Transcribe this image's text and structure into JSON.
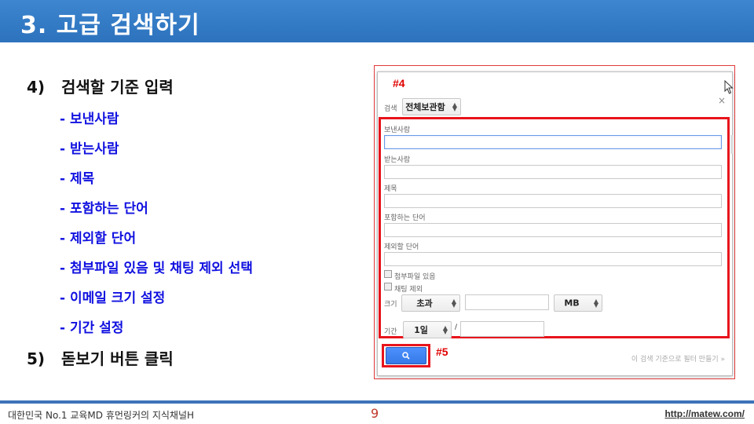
{
  "slide": {
    "title": "3. 고급 검색하기",
    "steps": [
      {
        "num": "4)",
        "text": "검색할 기준 입력"
      },
      {
        "num": "5)",
        "text": "돋보기 버튼 클릭"
      }
    ],
    "sub_items": [
      "- 보낸사람",
      "- 받는사람",
      "- 제목",
      "- 포함하는 단어",
      "- 제외할 단어",
      "- 첨부파일 있음 및 채팅 제외 선택",
      "- 이메일 크기 설정",
      "- 기간 설정"
    ]
  },
  "dialog": {
    "marker_4": "#4",
    "marker_5": "#5",
    "close": "×",
    "search_label": "검색",
    "search_scope": "전체보관함",
    "fields": [
      {
        "label": "보낸사람",
        "value": ""
      },
      {
        "label": "받는사람",
        "value": ""
      },
      {
        "label": "제목",
        "value": ""
      },
      {
        "label": "포함하는 단어",
        "value": ""
      },
      {
        "label": "제외할 단어",
        "value": ""
      }
    ],
    "has_attachment": "첨부파일 있음",
    "exclude_chats": "채팅 제외",
    "size_label": "크기",
    "size_op": "초과",
    "size_value": "",
    "size_unit": "MB",
    "date_label": "기간",
    "date_range": "1일",
    "date_sep": "/",
    "date_value": "",
    "create_filter": "이 검색 기준으로 필터 만들기 »",
    "search_icon": "search-icon"
  },
  "footer": {
    "left": "대한민국 No.1 교육MD 휴먼링커의 지식채널H",
    "page": "9",
    "url": "http://matew.com/"
  }
}
